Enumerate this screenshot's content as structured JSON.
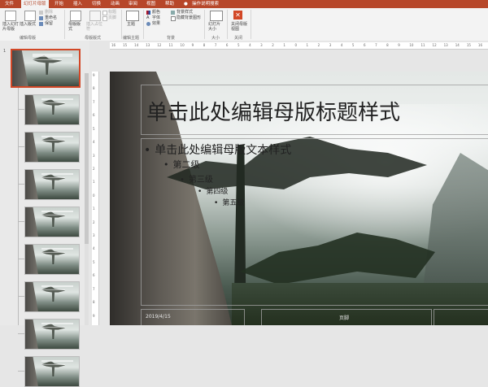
{
  "tabs": [
    {
      "label": "文件",
      "active": false
    },
    {
      "label": "幻灯片母版",
      "active": true
    },
    {
      "label": "开始",
      "active": false
    },
    {
      "label": "插入",
      "active": false
    },
    {
      "label": "切换",
      "active": false
    },
    {
      "label": "动画",
      "active": false
    },
    {
      "label": "审阅",
      "active": false
    },
    {
      "label": "视图",
      "active": false
    },
    {
      "label": "帮助",
      "active": false
    },
    {
      "label": "操作说明搜索",
      "active": false
    }
  ],
  "ribbon": {
    "insert_master": "插入幻灯片母版",
    "insert_layout": "插入版式",
    "delete": "删除",
    "rename": "重命名",
    "preserve": "保留",
    "group_edit_master": "编辑母版",
    "master_layout": "母版版式",
    "insert_placeholder": "插入占位符",
    "title_check": "标题",
    "footer_check": "页脚",
    "group_master_layout": "母版版式",
    "themes": "主题",
    "group_edit_theme": "编辑主题",
    "colors": "颜色",
    "fonts": "字体",
    "effects": "效果",
    "bg_styles": "背景样式",
    "hide_bg": "隐藏背景图形",
    "group_background": "背景",
    "slide_size": "幻灯片大小",
    "group_size": "大小",
    "close_view": "关闭母版视图",
    "group_close": "关闭"
  },
  "thumbnails": {
    "selected_number": "1",
    "count": 8
  },
  "slide": {
    "title": "单击此处编辑母版标题样式",
    "level1": "单击此处编辑母版文本样式",
    "level2": "第二级",
    "level3": "第三级",
    "level4": "第四级",
    "level5": "第五级",
    "date": "2019/4/15",
    "footer": "页脚"
  },
  "colors": {
    "accent": "#b7472a",
    "selection": "#d24726"
  }
}
